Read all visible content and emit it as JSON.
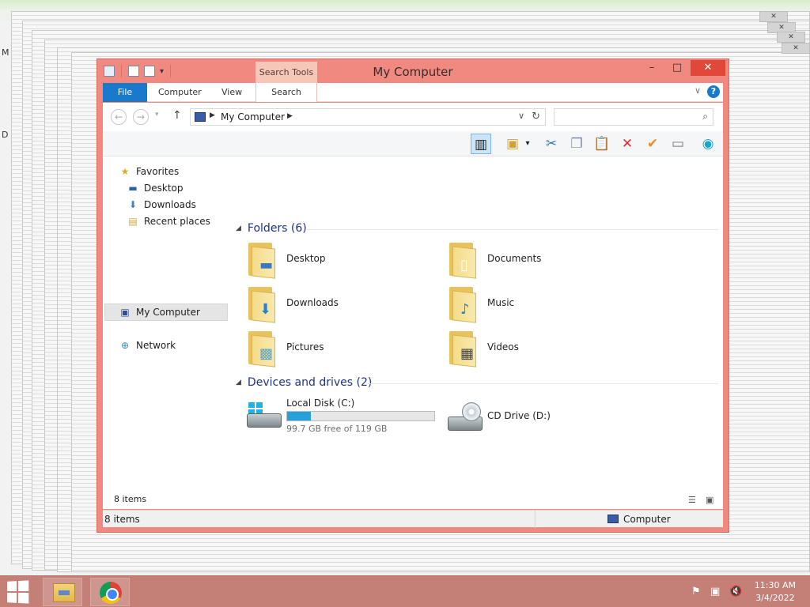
{
  "window": {
    "title": "My Computer",
    "context_tab": "Search Tools",
    "controls": {
      "minimize": "–",
      "maximize": "□",
      "close": "✕"
    }
  },
  "ribbon": {
    "tabs": [
      "File",
      "Computer",
      "View",
      "Search"
    ],
    "help": "?"
  },
  "address": {
    "crumb": "My Computer",
    "search_placeholder": ""
  },
  "nav_pane": {
    "favorites": "Favorites",
    "favorites_items": [
      "Desktop",
      "Downloads",
      "Recent places"
    ],
    "computer": "My Computer",
    "network": "Network"
  },
  "groups": {
    "folders_header": "Folders (6)",
    "folders": [
      "Desktop",
      "Documents",
      "Downloads",
      "Music",
      "Pictures",
      "Videos"
    ],
    "devices_header": "Devices and drives (2)",
    "drives": [
      {
        "name": "Local Disk (C:)",
        "free_text": "99.7 GB free of 119 GB",
        "used_fraction": 0.16
      },
      {
        "name": "CD Drive (D:)"
      }
    ]
  },
  "status": {
    "item_count_inner": "8 items",
    "item_count": "8 items",
    "location": "Computer"
  },
  "taskbar": {
    "time": "11:30 AM",
    "date": "3/4/2022"
  },
  "icons": {
    "favorites": "star-icon",
    "desktop": "desktop-icon",
    "downloads": "downloads-icon",
    "recent": "recent-places-icon",
    "computer": "computer-icon",
    "network": "network-icon"
  },
  "colors": {
    "window_frame": "#f08a80",
    "file_tab": "#1979ca",
    "drive_bar": "#26a0da",
    "taskbar": "#c47f77"
  }
}
